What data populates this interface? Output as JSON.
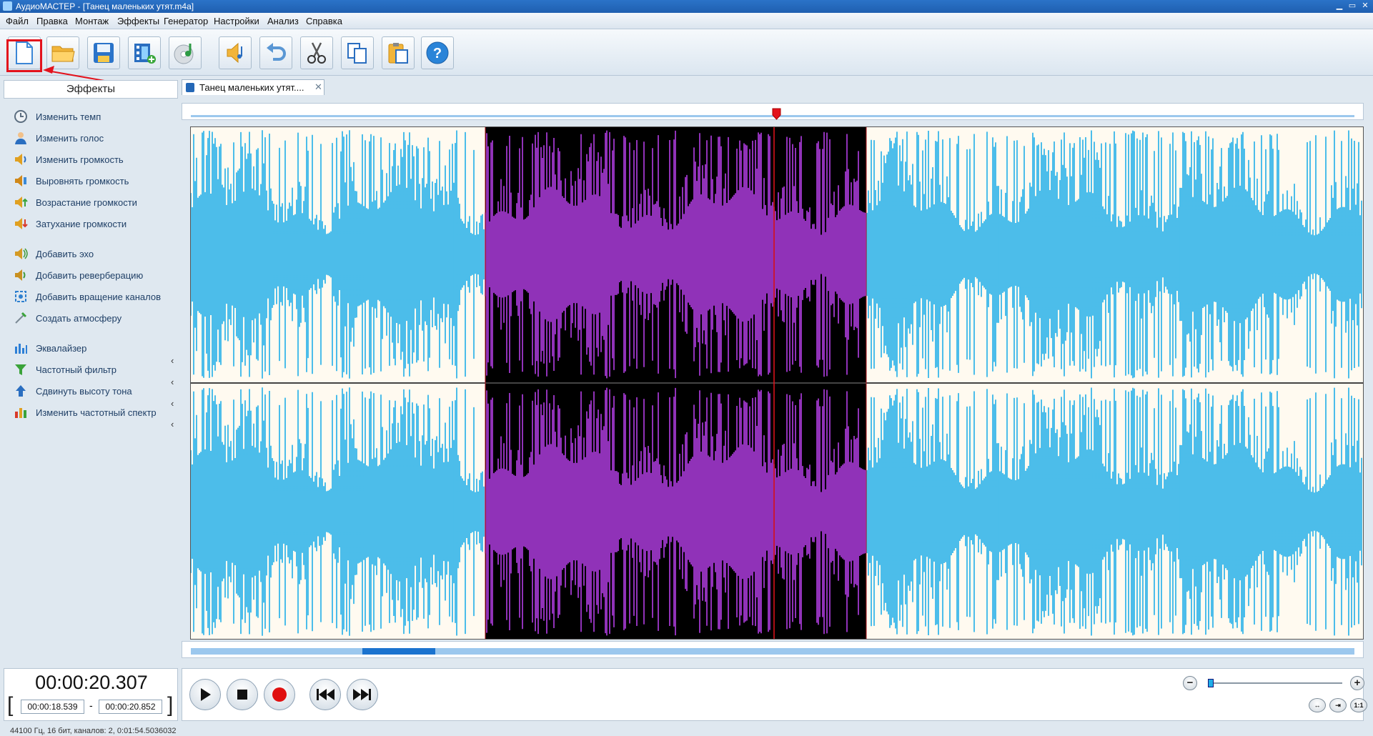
{
  "window": {
    "title": "АудиоМАСТЕР - [Танец маленьких утят.m4a]"
  },
  "menu": [
    "Файл",
    "Правка",
    "Монтаж",
    "Эффекты",
    "Генератор",
    "Настройки",
    "Анализ",
    "Справка"
  ],
  "toolbar": {
    "buttons": [
      "new-file",
      "open-folder",
      "save",
      "add-video",
      "burn-cd",
      "record-voice",
      "undo",
      "cut",
      "copy",
      "paste",
      "help"
    ]
  },
  "effects": {
    "header": "Эффекты",
    "items": [
      {
        "label": "Изменить темп",
        "icon": "clock-icon",
        "color": "#5c6e80"
      },
      {
        "label": "Изменить голос",
        "icon": "person-icon",
        "color": "#2a6ec0"
      },
      {
        "label": "Изменить громкость",
        "icon": "speaker-icon",
        "color": "#e0a020"
      },
      {
        "label": "Выровнять громкость",
        "icon": "speaker-level-icon",
        "color": "#d08818"
      },
      {
        "label": "Возрастание громкости",
        "icon": "speaker-up-icon",
        "color": "#4aa838"
      },
      {
        "label": "Затухание громкости",
        "icon": "speaker-down-icon",
        "color": "#d49a24"
      },
      {
        "label": "Добавить эхо",
        "icon": "echo-icon",
        "color": "#3f9a3a"
      },
      {
        "label": "Добавить реверберацию",
        "icon": "reverb-icon",
        "color": "#c89020"
      },
      {
        "label": "Добавить вращение каналов",
        "icon": "rotate-channels-icon",
        "color": "#2f80cf"
      },
      {
        "label": "Создать атмосферу",
        "icon": "atmosphere-icon",
        "color": "#7b8a95"
      },
      {
        "label": "Эквалайзер",
        "icon": "equalizer-icon",
        "color": "#2d7fd6"
      },
      {
        "label": "Частотный фильтр",
        "icon": "funnel-icon",
        "color": "#3aa33a"
      },
      {
        "label": "Сдвинуть высоту тона",
        "icon": "pitch-icon",
        "color": "#2a6ec0"
      },
      {
        "label": "Изменить частотный спектр",
        "icon": "spectrum-icon",
        "color": "#d83a2a"
      }
    ]
  },
  "tab": {
    "label": "Танец маленьких утят...."
  },
  "waveform": {
    "color": "#1faee8",
    "selection_color": "#b43ee6",
    "selection_bg": "#000000",
    "background": "#fffaf0"
  },
  "playback": {
    "current_time": "00:00:20.307",
    "selection_start": "00:00:18.539",
    "selection_end": "00:00:20.852",
    "dash": "-"
  },
  "zoom": {
    "minus": "−",
    "plus": "+",
    "fit_label": "1:1"
  },
  "status": "44100 Гц, 16 бит, каналов: 2, 0:01:54.5036032"
}
